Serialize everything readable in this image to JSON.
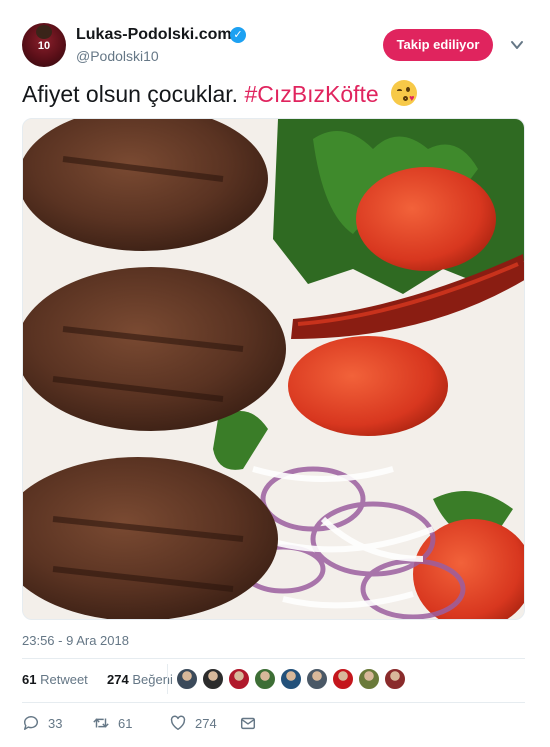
{
  "user": {
    "display_name": "Lukas-Podolski.com",
    "handle": "@Podolski10",
    "avatar_number": "10",
    "follow_label": "Takip ediliyor"
  },
  "tweet": {
    "text": "Afiyet olsun çocuklar. ",
    "hashtag": "#CızBızKöfte",
    "emoji": "face-blowing-kiss-icon",
    "timestamp": "23:56 - 9 Ara 2018"
  },
  "stats": {
    "retweets_count": "61",
    "retweets_label": "Retweet",
    "likes_count": "274",
    "likes_label": "Beğeni"
  },
  "actions": {
    "reply_count": "33",
    "retweet_count": "61",
    "like_count": "274"
  },
  "colors": {
    "accent": "#e0245e",
    "verified": "#1da1f2",
    "muted": "#657786",
    "text": "#14171a"
  },
  "likers": [
    "#3b4a5a",
    "#2c2c2c",
    "#b0182b",
    "#3d6e35",
    "#23517a",
    "#4a5866",
    "#c4161c",
    "#6a7a3a",
    "#8a2b2b"
  ]
}
